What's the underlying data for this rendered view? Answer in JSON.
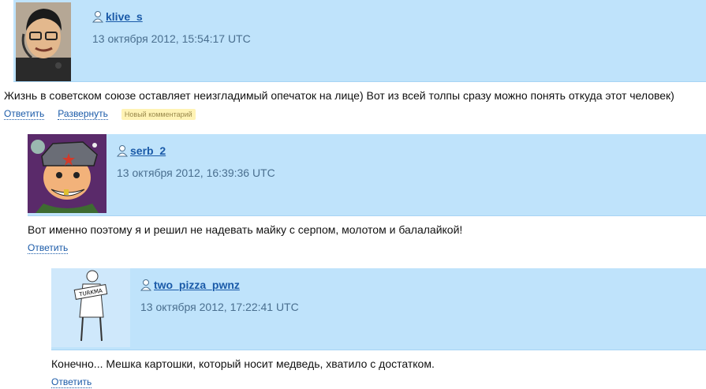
{
  "comments": [
    {
      "username": "klive_s",
      "date": "13 октября 2012, 15:54:17 UTC",
      "text": "Жизнь в советском союзе оставляет неизгладимый опечаток на лице) Вот из всей толпы сразу можно понять откуда этот человек)",
      "reply_label": "Ответить",
      "expand_label": "Развернуть",
      "badge": "Новый комментарий"
    },
    {
      "username": "serb_2",
      "date": "13 октября 2012, 16:39:36 UTC",
      "text": "Вот именно поэтому я и решил не надевать майку с серпом, молотом и балалайкой!",
      "reply_label": "Ответить"
    },
    {
      "username": "two_pizza_pwnz",
      "date": "13 октября 2012, 17:22:41 UTC",
      "text": "Конечно... Мешка картошки, который носит медведь, хватило с достатком.",
      "reply_label": "Ответить",
      "avatar_sign": "TURKMA"
    }
  ],
  "colors": {
    "header_bg": "#bfe3fb",
    "link": "#1a5aa8",
    "date": "#4a6f8f",
    "badge_bg": "#fff3b5"
  }
}
